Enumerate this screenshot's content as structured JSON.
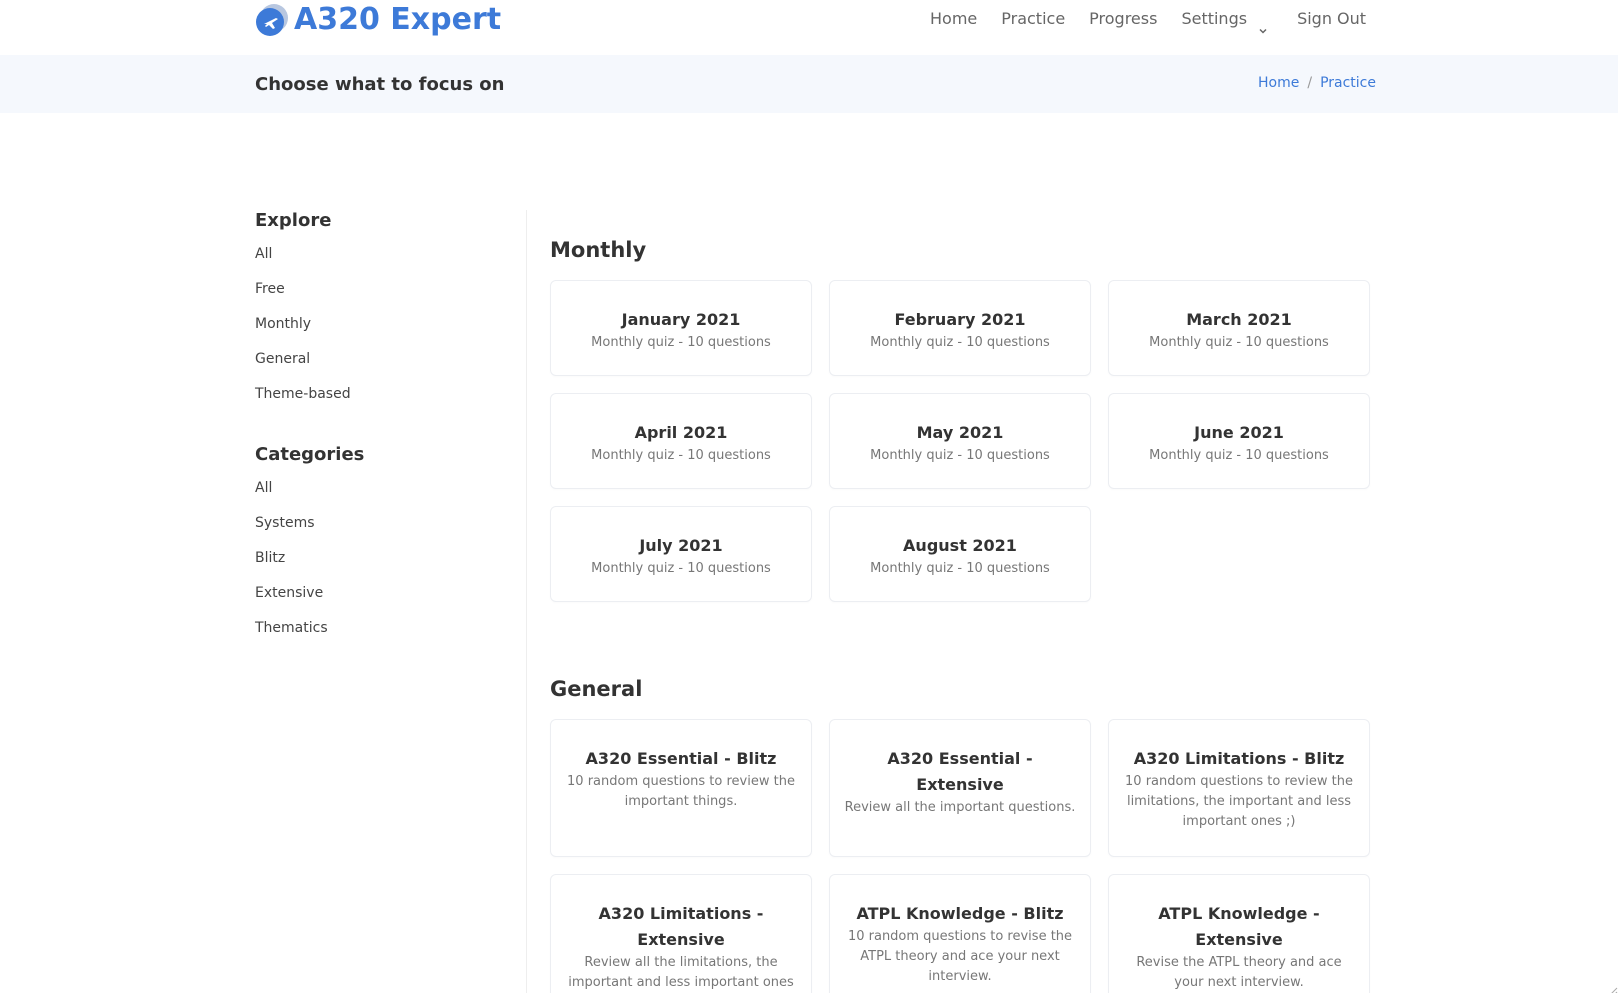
{
  "header": {
    "brand": "A320 Expert",
    "nav": [
      "Home",
      "Practice",
      "Progress"
    ],
    "settings_label": "Settings",
    "signout_label": "Sign Out",
    "colors": {
      "accent": "#3d7ad8",
      "crumb_bg": "#f5f8fd"
    }
  },
  "crumbbar": {
    "title": "Choose what to focus on",
    "crumbs": [
      "Home",
      "Practice"
    ],
    "separator": "/"
  },
  "sidebar": {
    "explore": {
      "heading": "Explore",
      "items": [
        "All",
        "Free",
        "Monthly",
        "General",
        "Theme-based"
      ]
    },
    "categories": {
      "heading": "Categories",
      "items": [
        "All",
        "Systems",
        "Blitz",
        "Extensive",
        "Thematics"
      ]
    }
  },
  "monthly": {
    "heading": "Monthly",
    "cards": [
      {
        "title": "January 2021",
        "subtitle": "Monthly quiz - 10 questions"
      },
      {
        "title": "February 2021",
        "subtitle": "Monthly quiz - 10 questions"
      },
      {
        "title": "March 2021",
        "subtitle": "Monthly quiz - 10 questions"
      },
      {
        "title": "April 2021",
        "subtitle": "Monthly quiz - 10 questions"
      },
      {
        "title": "May 2021",
        "subtitle": "Monthly quiz - 10 questions"
      },
      {
        "title": "June 2021",
        "subtitle": "Monthly quiz - 10 questions"
      },
      {
        "title": "July 2021",
        "subtitle": "Monthly quiz - 10 questions"
      },
      {
        "title": "August 2021",
        "subtitle": "Monthly quiz - 10 questions"
      }
    ]
  },
  "general": {
    "heading": "General",
    "cards": [
      {
        "title": "A320 Essential - Blitz",
        "subtitle": "10 random questions to review the important things."
      },
      {
        "title": "A320 Essential - Extensive",
        "subtitle": "Review all the important questions."
      },
      {
        "title": "A320 Limitations - Blitz",
        "subtitle": "10 random questions to review the limitations, the important and less important ones ;)"
      },
      {
        "title": "A320 Limitations - Extensive",
        "subtitle": "Review all the limitations, the important and less important ones ;)"
      },
      {
        "title": "ATPL Knowledge - Blitz",
        "subtitle": "10 random questions to revise the ATPL theory and ace your next interview."
      },
      {
        "title": "ATPL Knowledge - Extensive",
        "subtitle": "Revise the ATPL theory and ace your next interview."
      }
    ]
  }
}
